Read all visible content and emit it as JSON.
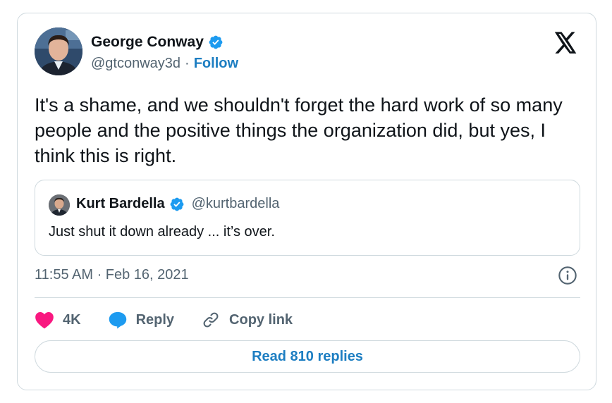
{
  "author": {
    "name": "George Conway",
    "handle": "@gtconway3d",
    "separator": "·",
    "follow_label": "Follow"
  },
  "tweet": {
    "text": "It's a shame, and we shouldn't forget the hard work of so many people and the positive things the organization did, but yes, I think this is right.",
    "timestamp": "11:55 AM · Feb 16, 2021"
  },
  "quote": {
    "name": "Kurt Bardella",
    "handle": "@kurtbardella",
    "text": "Just shut it down already ... it’s over."
  },
  "actions": {
    "like_count": "4K",
    "reply_label": "Reply",
    "copy_label": "Copy link"
  },
  "read_replies_label": "Read 810 replies",
  "colors": {
    "accent": "#1d7ec2",
    "verified": "#1d9bf0",
    "like": "#f91880",
    "muted": "#536471",
    "border": "#cfd9de"
  },
  "icons": {
    "brand": "x-logo-icon",
    "verified": "verified-badge-icon",
    "info": "info-icon",
    "like": "heart-icon",
    "reply": "speech-bubble-icon",
    "copy": "link-icon"
  }
}
